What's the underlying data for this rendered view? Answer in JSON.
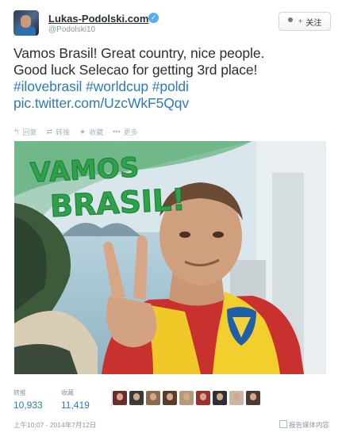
{
  "author": {
    "name": "Lukas-Podolski.com",
    "handle": "@Podolski10",
    "verified": true
  },
  "follow_button": {
    "label": "关注",
    "icon": "add-user-icon"
  },
  "tweet": {
    "lines": [
      "Vamos Brasil! Great country, nice people.",
      "Good luck Selecao for getting 3rd place!"
    ],
    "hashtags": "#ilovebrasil #worldcup #poldi",
    "link": "pic.twitter.com/UzcWkF5Qqv"
  },
  "actions": [
    {
      "label": "回复",
      "icon": "reply-icon"
    },
    {
      "label": "转推",
      "icon": "retweet-icon"
    },
    {
      "label": "收藏",
      "icon": "star-icon"
    },
    {
      "label": "更多",
      "icon": "more-icon"
    }
  ],
  "photo": {
    "overlay_text_1": "VAMOS",
    "overlay_text_2": "BRASIL!"
  },
  "stats": {
    "retweets_label": "转推",
    "retweets_value": "10,933",
    "favorites_label": "收藏",
    "favorites_value": "11,419"
  },
  "footer": {
    "timestamp": "上午10:07 - 2014年7月12日",
    "report": "报告媒体内容"
  },
  "colors": {
    "link": "#2b7bb9",
    "verified": "#55acee",
    "muted": "#8899a6"
  }
}
